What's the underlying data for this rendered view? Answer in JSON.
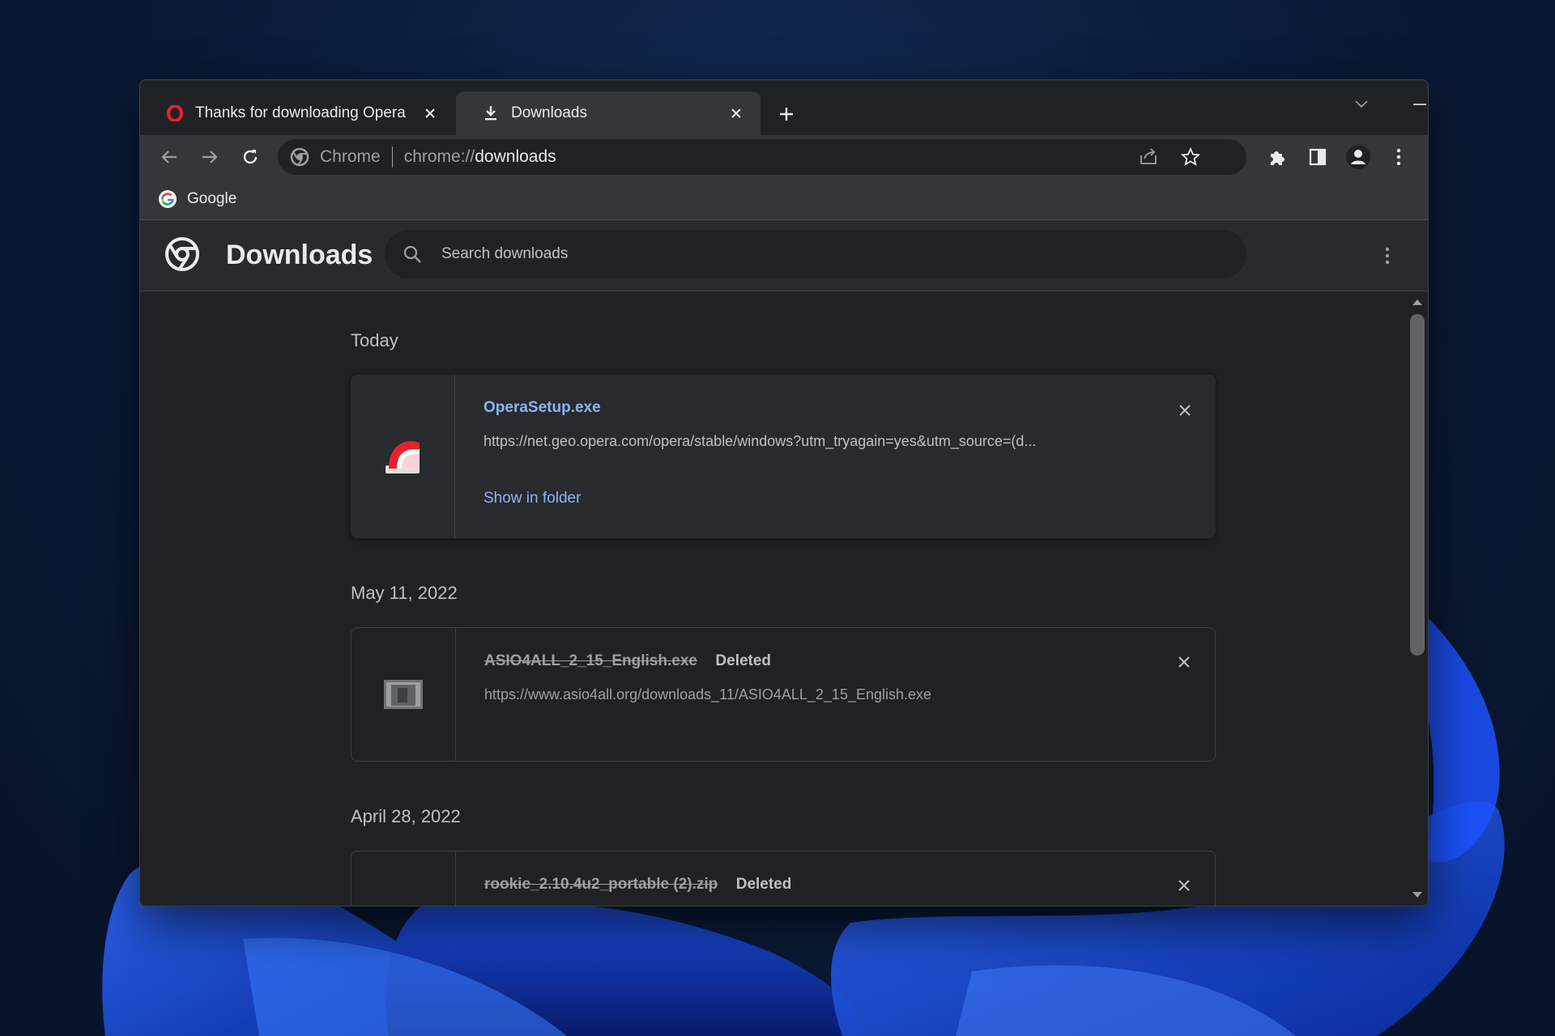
{
  "tabs": [
    {
      "title": "Thanks for downloading Opera",
      "icon": "opera-icon",
      "active": false
    },
    {
      "title": "Downloads",
      "icon": "download-icon",
      "active": true
    }
  ],
  "toolbar": {
    "chip_label": "Chrome",
    "url_scheme": "chrome://",
    "url_path": "downloads"
  },
  "bookmarks": [
    {
      "label": "Google",
      "icon": "google-icon"
    }
  ],
  "downloads_page": {
    "title": "Downloads",
    "search_placeholder": "Search downloads"
  },
  "groups": [
    {
      "date": "Today",
      "items": [
        {
          "filename": "OperaSetup.exe",
          "status": "",
          "url": "https://net.geo.opera.com/opera/stable/windows?utm_tryagain=yes&utm_source=(d...",
          "action": "Show in folder",
          "deleted": false
        }
      ]
    },
    {
      "date": "May 11, 2022",
      "items": [
        {
          "filename": "ASIO4ALL_2_15_English.exe",
          "status": "Deleted",
          "url": "https://www.asio4all.org/downloads_11/ASIO4ALL_2_15_English.exe",
          "action": "",
          "deleted": true
        }
      ]
    },
    {
      "date": "April 28, 2022",
      "items": [
        {
          "filename": "rookie_2.10.4u2_portable (2).zip",
          "status": "Deleted",
          "url": "",
          "action": "",
          "deleted": true
        }
      ]
    }
  ],
  "colors": {
    "accent_link": "#8ab4f8",
    "window_bg": "#202124",
    "toolbar_bg": "#35363a",
    "opera_red": "#e8222d"
  }
}
